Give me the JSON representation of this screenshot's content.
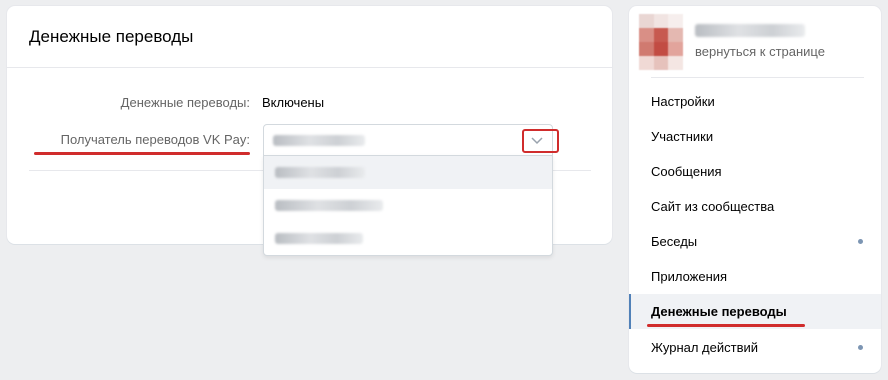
{
  "main": {
    "title": "Денежные переводы",
    "transfers_label": "Денежные переводы:",
    "transfers_value": "Включены",
    "recipient_label": "Получатель переводов VK Pay:",
    "recipient_selected": "redacted",
    "dropdown_options": [
      "redacted",
      "redacted",
      "redacted"
    ]
  },
  "sidebar": {
    "profile_name": "redacted",
    "back_link": "вернуться к странице",
    "items": [
      {
        "label": "Настройки",
        "selected": false,
        "dot": false
      },
      {
        "label": "Участники",
        "selected": false,
        "dot": false
      },
      {
        "label": "Сообщения",
        "selected": false,
        "dot": false
      },
      {
        "label": "Сайт из сообщества",
        "selected": false,
        "dot": false
      },
      {
        "label": "Беседы",
        "selected": false,
        "dot": true
      },
      {
        "label": "Приложения",
        "selected": false,
        "dot": false
      },
      {
        "label": "Денежные переводы",
        "selected": true,
        "dot": false
      },
      {
        "label": "Журнал действий",
        "selected": false,
        "dot": true
      }
    ]
  },
  "colors": {
    "background": "#edeef0",
    "annotation_red": "#d02c2c",
    "accent_blue": "#5181b8",
    "dot_blue": "#7c95b3"
  }
}
